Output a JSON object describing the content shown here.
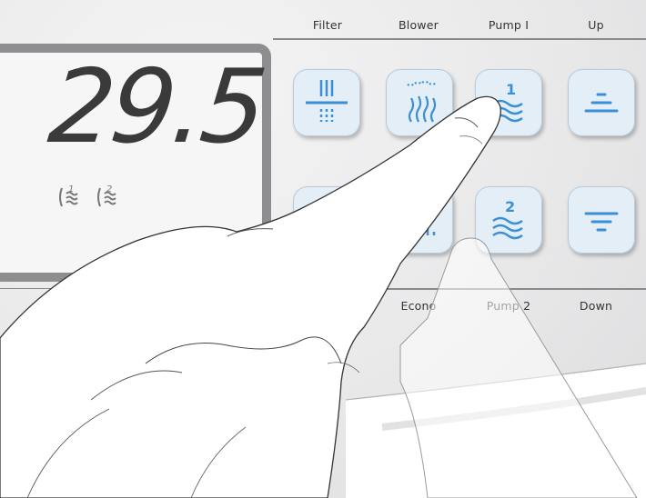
{
  "display": {
    "temperature": "29.5",
    "indicators": [
      {
        "icon": "pump-1-indicator-icon",
        "number": "1"
      },
      {
        "icon": "pump-2-indicator-icon",
        "number": "2"
      }
    ]
  },
  "top_labels": {
    "filter": "Filter",
    "blower": "Blower",
    "pump1": "Pump I",
    "up": "Up"
  },
  "bottom_labels": {
    "econo": "Econo",
    "pump2": "Pump 2",
    "down": "Down"
  },
  "keys": {
    "pump1_number": "1",
    "pump2_number": "2"
  },
  "colors": {
    "icon_blue": "#3a8fd6",
    "key_fill": "#e3eef7",
    "display_border": "#8e8e90",
    "digits": "#3a3a3a"
  }
}
